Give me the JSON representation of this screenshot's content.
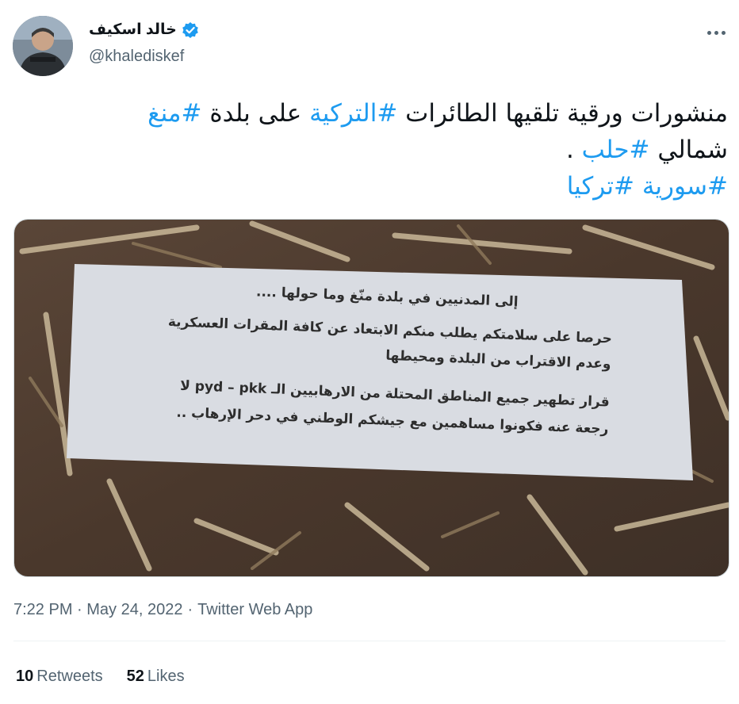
{
  "author": {
    "display_name": "خالد اسكيف",
    "handle": "@khalediskef",
    "verified": true
  },
  "tweet": {
    "line1": [
      {
        "text": "منشورات ورقية تلقيها الطائرات ",
        "tag": false
      },
      {
        "text": "#التركية",
        "tag": true
      },
      {
        "text": "  على بلدة ",
        "tag": false
      },
      {
        "text": "#منغ",
        "tag": true
      }
    ],
    "line2": [
      {
        "text": "شمالي ",
        "tag": false
      },
      {
        "text": "#حلب",
        "tag": true
      },
      {
        "text": " .",
        "tag": false
      }
    ],
    "line3": [
      {
        "text": "#سورية",
        "tag": true
      },
      {
        "text": " ",
        "tag": false
      },
      {
        "text": "#تركيا",
        "tag": true
      }
    ]
  },
  "image": {
    "leaflet_lines": [
      "إلى المدنيين في بلدة منّغ وما حولها ....",
      "حرصا على سلامتكم يطلب منكم الابتعاد عن كافة المقرات العسكرية",
      "وعدم الاقتراب من البلدة ومحيطها",
      "قرار تطهير جميع المناطق المحتلة من الارهابيين الـ pyd – pkk  لا",
      "رجعة عنه  فكونوا مساهمين مع جيشكم الوطني في دحر الإرهاب .."
    ]
  },
  "meta": {
    "time": "7:22 PM · May 24, 2022",
    "separator": "·",
    "source": "Twitter Web App"
  },
  "stats": {
    "retweets_count": "10",
    "retweets_label": "Retweets",
    "likes_count": "52",
    "likes_label": "Likes"
  },
  "colors": {
    "link": "#1d9bf0",
    "text": "#0f1419",
    "secondary": "#536471"
  },
  "icons": {
    "verified": "verified-badge-icon",
    "more": "more-options-icon"
  }
}
